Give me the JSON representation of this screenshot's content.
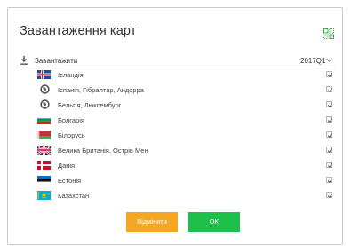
{
  "dialog": {
    "title": "Завантаження карт"
  },
  "list_header": {
    "label": "Завантажити",
    "version": "2017Q1"
  },
  "countries": [
    {
      "name": "Ісландія",
      "icon": "flag-iceland",
      "checked": true
    },
    {
      "name": "Іспанія, Гібралтар, Андорра",
      "icon": "globe-icon",
      "checked": true
    },
    {
      "name": "Бельгія, Люксембург",
      "icon": "globe-icon",
      "checked": true
    },
    {
      "name": "Болгарія",
      "icon": "flag-bulgaria",
      "checked": true
    },
    {
      "name": "Білорусь",
      "icon": "flag-belarus",
      "checked": true
    },
    {
      "name": "Велика Британія, Острів Мен",
      "icon": "flag-uk",
      "checked": true
    },
    {
      "name": "Данія",
      "icon": "flag-denmark",
      "checked": true
    },
    {
      "name": "Естонія",
      "icon": "flag-estonia",
      "checked": true
    },
    {
      "name": "Казахстан",
      "icon": "flag-kazakhstan",
      "checked": true
    }
  ],
  "buttons": {
    "cancel": "Відмінити",
    "ok": "OK"
  },
  "colors": {
    "cancel": "#f5a623",
    "ok": "#1fbf4c",
    "accent_icon": "#2db34a"
  }
}
